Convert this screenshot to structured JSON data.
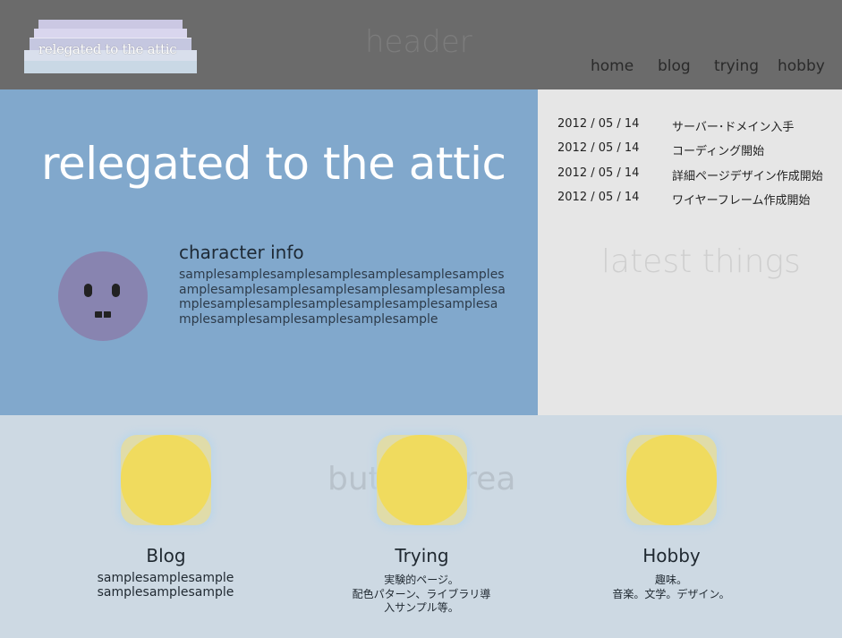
{
  "header": {
    "logo_text": "relegated to the attic",
    "section_label": "header",
    "nav": [
      "home",
      "blog",
      "trying",
      "hobby"
    ]
  },
  "main": {
    "title": "relegated to the attic",
    "character": {
      "title": "character info",
      "body": "samplesamplesamplesamplesamplesamplesamplesamplesamplesamplesamplesamplesamplesamplesamplesamplesamplesamplesamplesamplesamplesamplesamplesamplesamplesamplesample"
    }
  },
  "sidebar": {
    "section_label": "latest things",
    "news": [
      {
        "date": "2012 / 05 / 14",
        "text": "サーバー･ドメイン入手"
      },
      {
        "date": "2012 / 05 / 14",
        "text": "コーディング開始"
      },
      {
        "date": "2012 / 05 / 14",
        "text": "詳細ページデザイン作成開始"
      },
      {
        "date": "2012 / 05 / 14",
        "text": "ワイヤーフレーム作成開始"
      }
    ]
  },
  "buttons": {
    "section_label": "button area",
    "items": [
      {
        "title": "Blog",
        "desc_lines": [
          "samplesamplesample",
          "samplesamplesample"
        ]
      },
      {
        "title": "Trying",
        "desc_lines": [
          "実験的ページ。",
          "配色パターン、ライブラリ導",
          "入サンプル等。"
        ]
      },
      {
        "title": "Hobby",
        "desc_lines": [
          "趣味。",
          "音楽。文学。デザイン。"
        ]
      }
    ]
  },
  "colors": {
    "header_bg": "#6b6b6b",
    "main_bg": "#81a8cc",
    "sidebar_bg": "#e6e6e6",
    "buttons_bg": "#cdd9e3",
    "accent_yellow": "#f0db5e",
    "avatar": "#8884b0"
  }
}
